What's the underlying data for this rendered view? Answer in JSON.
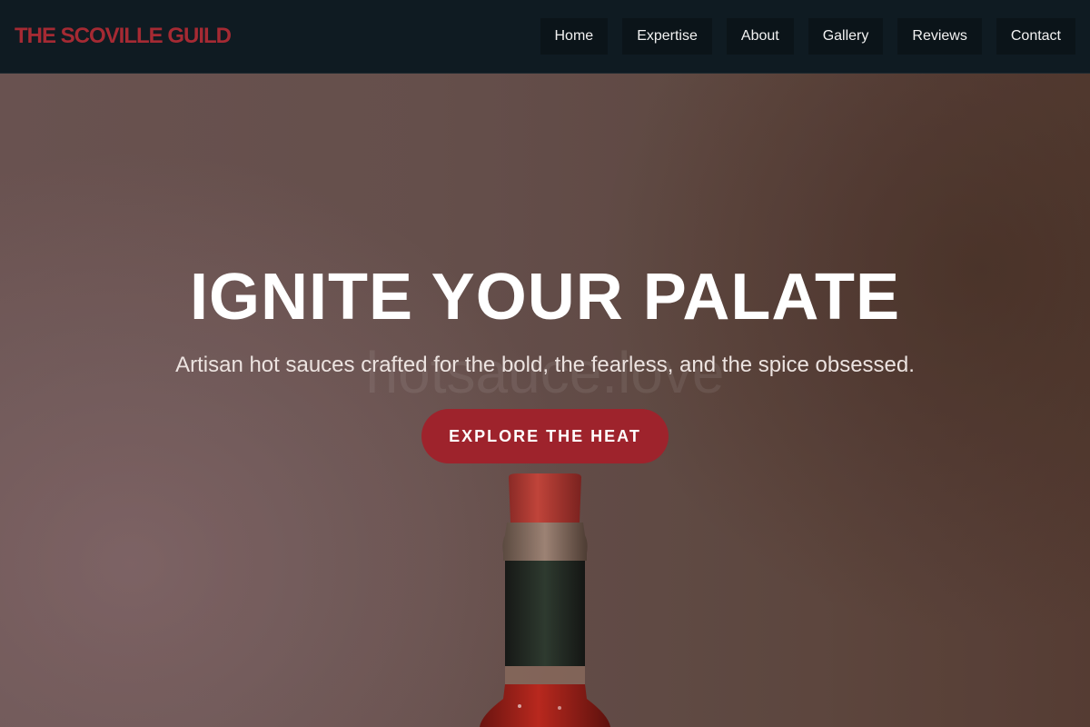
{
  "header": {
    "logo": "THE SCOVILLE GUILD",
    "nav": [
      "Home",
      "Expertise",
      "About",
      "Gallery",
      "Reviews",
      "Contact"
    ]
  },
  "hero": {
    "title": "IGNITE YOUR PALATE",
    "subtitle": "Artisan hot sauces crafted for the bold, the fearless, and the spice obsessed.",
    "watermark": "hotsauce.love",
    "cta_label": "EXPLORE THE HEAT"
  },
  "colors": {
    "brand_red": "#a52a33",
    "button_red": "#9e232c",
    "header_bg": "#0f1b22"
  }
}
